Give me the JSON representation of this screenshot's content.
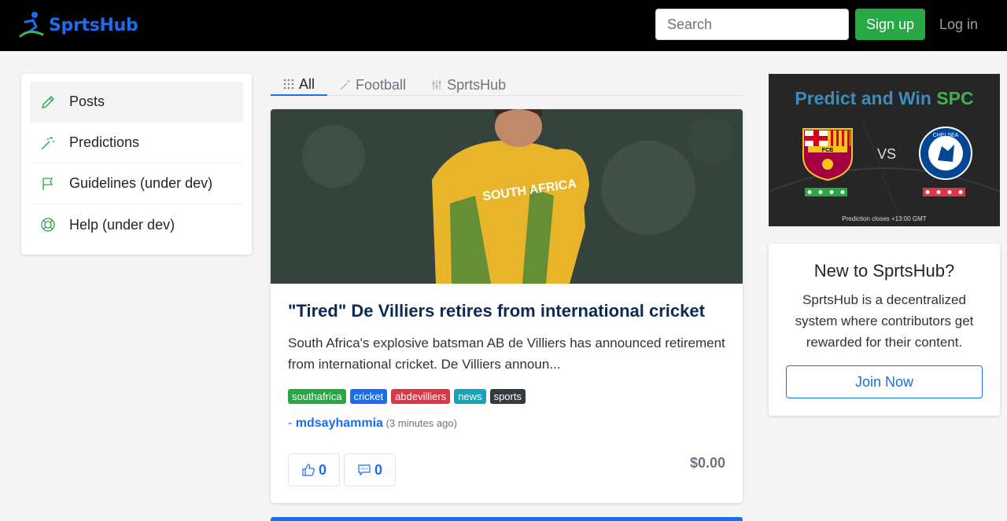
{
  "header": {
    "brand": "SprtsHub",
    "search_placeholder": "Search",
    "signup_label": "Sign up",
    "login_label": "Log in"
  },
  "sidebar": {
    "items": [
      {
        "label": "Posts",
        "icon": "pencil-icon"
      },
      {
        "label": "Predictions",
        "icon": "magic-wand-icon"
      },
      {
        "label": "Guidelines (under dev)",
        "icon": "flag-icon"
      },
      {
        "label": "Help (under dev)",
        "icon": "lifebuoy-icon"
      }
    ]
  },
  "tabs": [
    {
      "label": "All",
      "icon": "grid-icon"
    },
    {
      "label": "Football",
      "icon": "magic-wand-icon"
    },
    {
      "label": "SprtsHub",
      "icon": "sliders-icon"
    }
  ],
  "post": {
    "title": "\"Tired\" De Villiers retires from international cricket",
    "excerpt": "South Africa's explosive batsman AB de Villiers has announced retirement from international cricket. De Villiers announ...",
    "tags": [
      {
        "label": "southafrica",
        "color": "#28a745"
      },
      {
        "label": "cricket",
        "color": "#1b6df0"
      },
      {
        "label": "abdevilliers",
        "color": "#dc3545"
      },
      {
        "label": "news",
        "color": "#17a2b8"
      },
      {
        "label": "sports",
        "color": "#343a40"
      }
    ],
    "author_prefix": "- ",
    "author": "mdsayhammia",
    "time_ago": "(3 minutes ago)",
    "likes": "0",
    "comments": "0",
    "payout": "$0.00",
    "image_text": "SOUTH AFRICA"
  },
  "promo": {
    "title_part1": "Predict and Win ",
    "title_part2": "SPC",
    "vs": "VS",
    "home_crest": "FCB",
    "away_crest": "CHELSEA",
    "footer": "Prediction closes +13:00 GMT"
  },
  "new_card": {
    "heading": "New to SprtsHub?",
    "text": "SprtsHub is a decentralized system where contributors get rewarded for their content.",
    "button": "Join Now"
  }
}
